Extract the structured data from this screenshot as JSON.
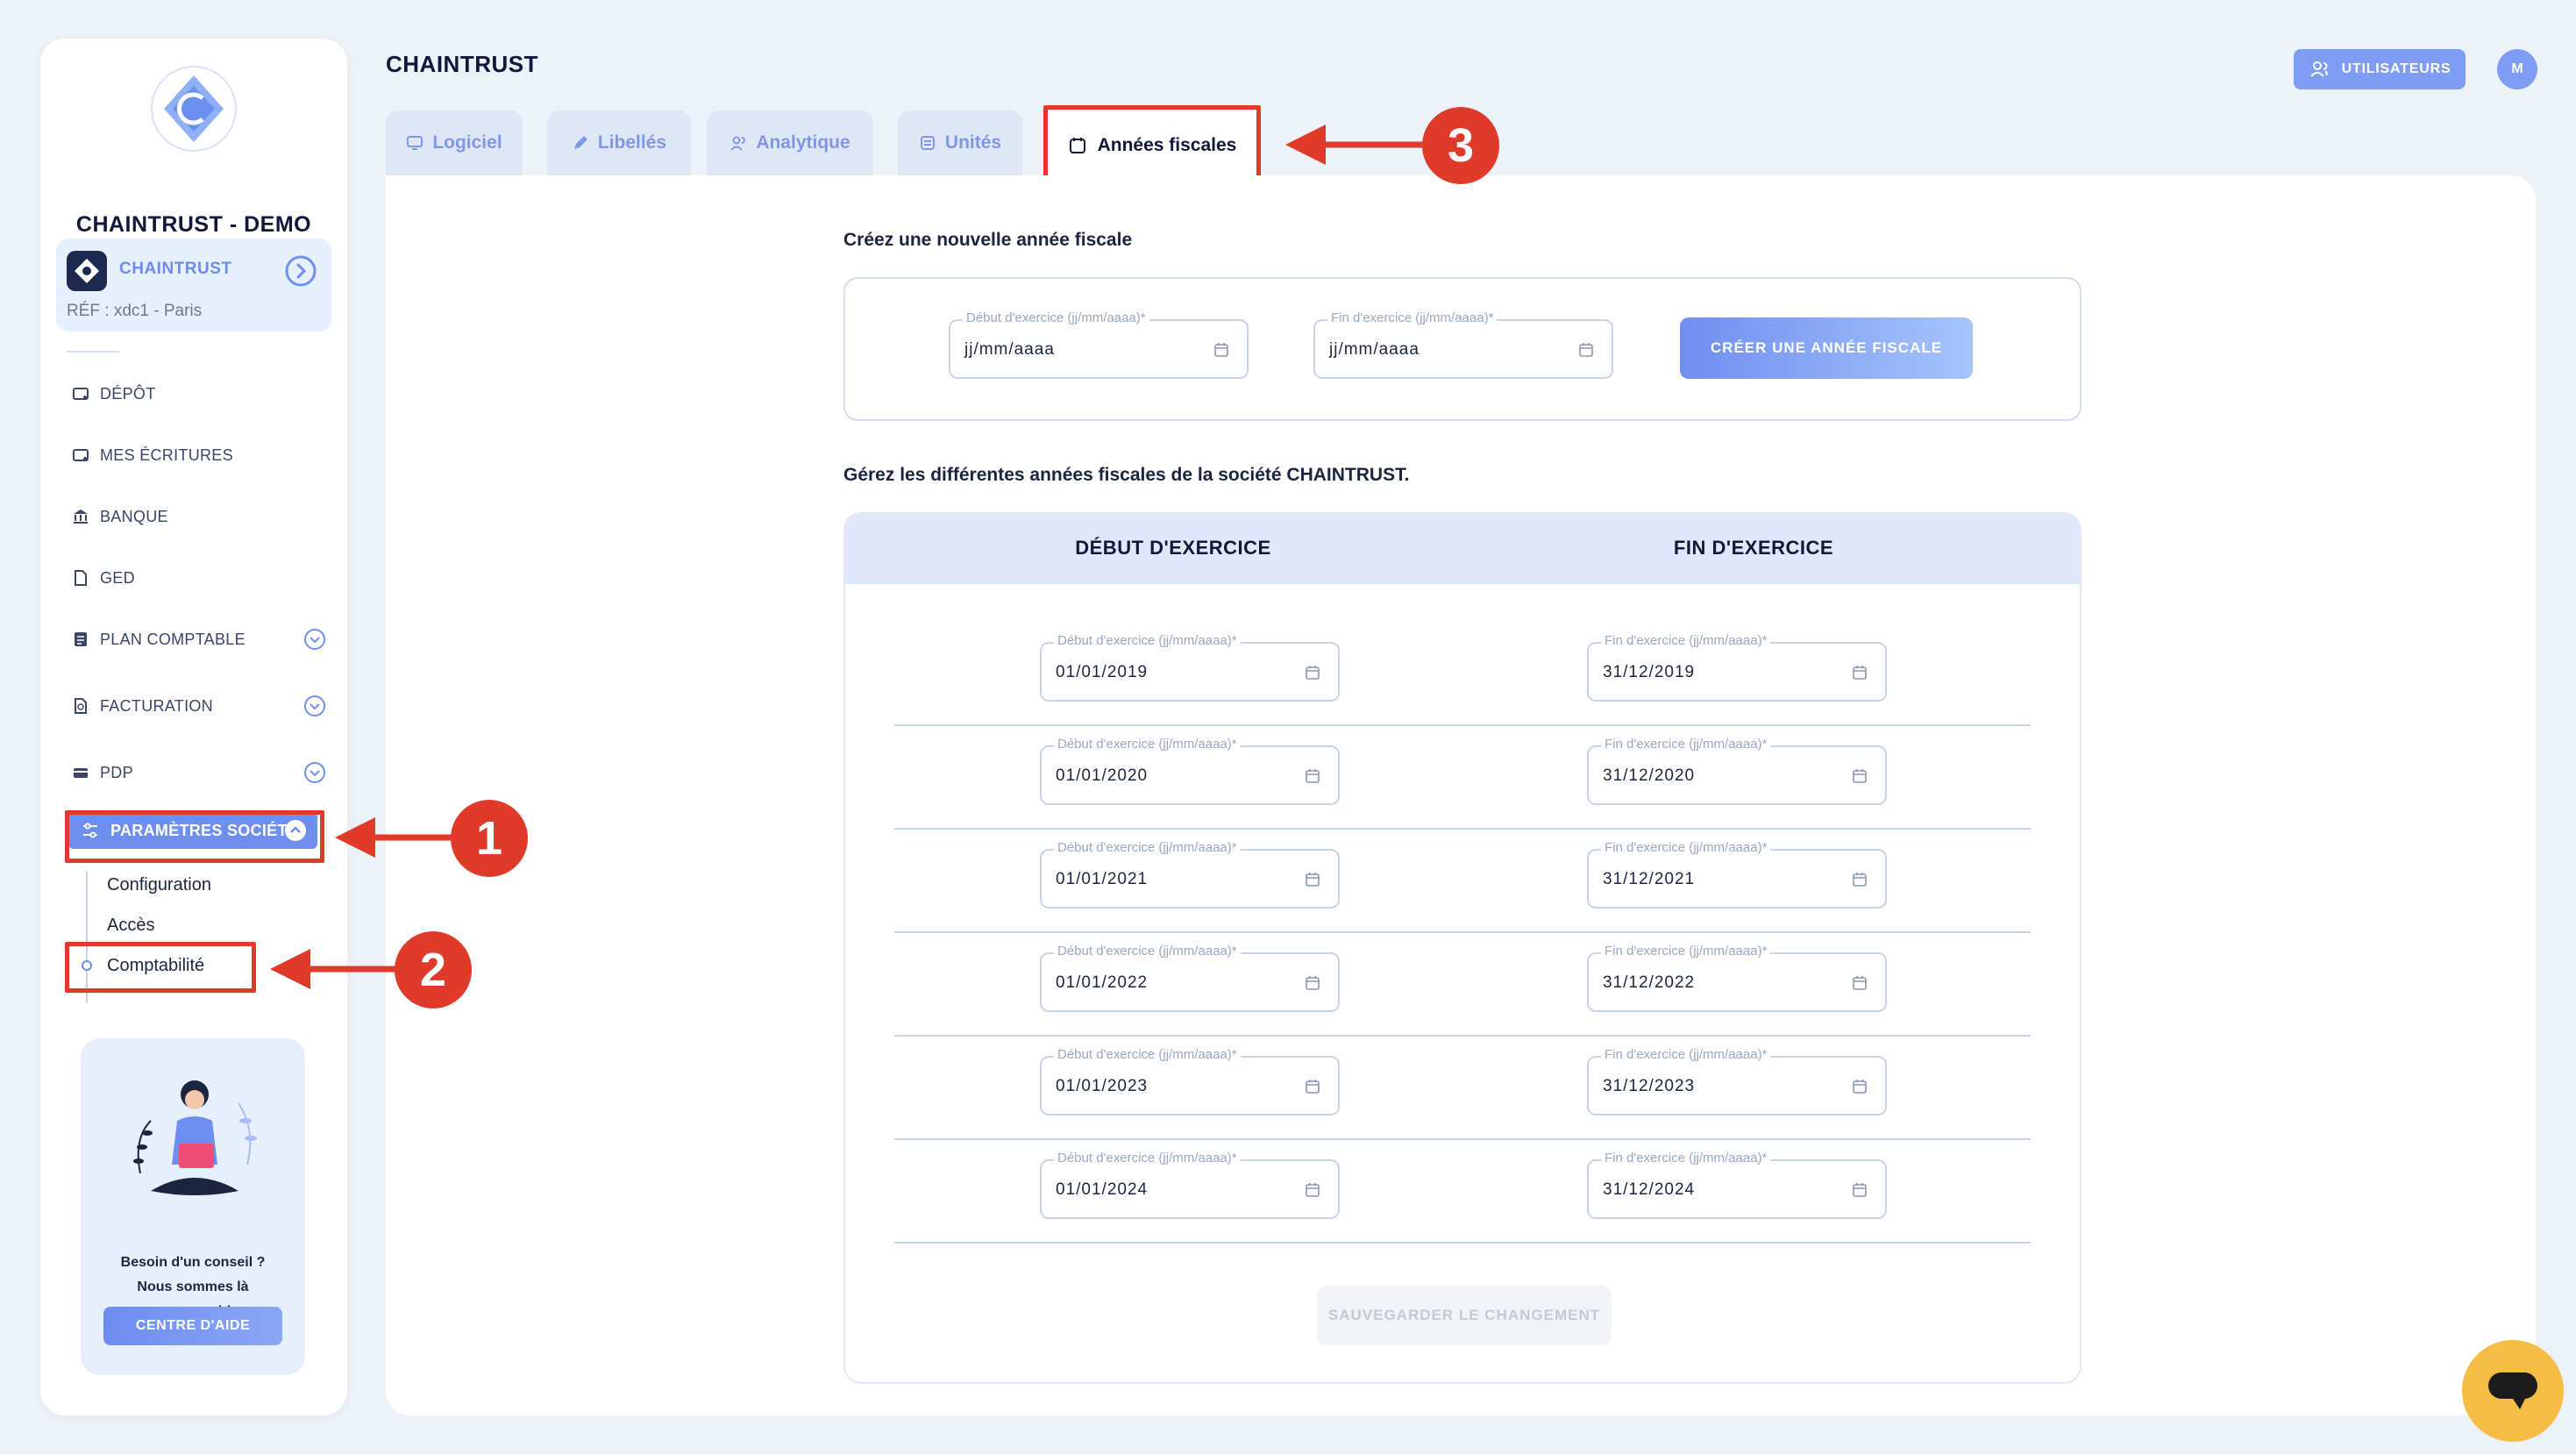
{
  "app": {
    "company_name": "CHAINTRUST - DEMO",
    "page_title": "CHAINTRUST"
  },
  "company_card": {
    "name": "CHAINTRUST",
    "ref": "RÉF : xdc1 - Paris"
  },
  "sidebar": {
    "items": [
      {
        "label": "DÉPÔT",
        "icon": "deposit-icon"
      },
      {
        "label": "MES ÉCRITURES",
        "icon": "entries-icon"
      },
      {
        "label": "BANQUE",
        "icon": "bank-icon"
      },
      {
        "label": "GED",
        "icon": "document-icon"
      },
      {
        "label": "PLAN COMPTABLE",
        "icon": "ledger-icon"
      },
      {
        "label": "FACTURATION",
        "icon": "invoice-icon"
      },
      {
        "label": "PDP",
        "icon": "card-icon"
      }
    ],
    "active_item": "PARAMÈTRES SOCIÉTÉ",
    "sub_items": [
      "Configuration",
      "Accès",
      "Comptabilité"
    ]
  },
  "help": {
    "line1": "Besoin d'un conseil ?",
    "line2": "Nous sommes là",
    "line3": "pour vous aider.",
    "button": "CENTRE D'AIDE"
  },
  "header": {
    "users_button": "UTILISATEURS",
    "avatar_initial": "M"
  },
  "tabs": [
    {
      "label": "Logiciel",
      "icon": "monitor-icon"
    },
    {
      "label": "Libellés",
      "icon": "pencil-icon"
    },
    {
      "label": "Analytique",
      "icon": "users-icon"
    },
    {
      "label": "Unités",
      "icon": "stack-icon"
    },
    {
      "label": "Années fiscales",
      "icon": "calendar-icon",
      "active": true
    }
  ],
  "create": {
    "title": "Créez une nouvelle année fiscale",
    "start_label": "Début d'exercice (jj/mm/aaaa)*",
    "start_value": "jj/mm/aaaa",
    "end_label": "Fin d'exercice (jj/mm/aaaa)*",
    "end_value": "jj/mm/aaaa",
    "button": "CRÉER UNE ANNÉE FISCALE"
  },
  "manage": {
    "title": "Gérez les différentes années fiscales de la société CHAINTRUST.",
    "col_start": "DÉBUT D'EXERCICE",
    "col_end": "FIN D'EXERCICE",
    "field_start_label": "Début d'exercice (jj/mm/aaaa)*",
    "field_end_label": "Fin d'exercice (jj/mm/aaaa)*",
    "rows": [
      {
        "start": "01/01/2019",
        "end": "31/12/2019"
      },
      {
        "start": "01/01/2020",
        "end": "31/12/2020"
      },
      {
        "start": "01/01/2021",
        "end": "31/12/2021"
      },
      {
        "start": "01/01/2022",
        "end": "31/12/2022"
      },
      {
        "start": "01/01/2023",
        "end": "31/12/2023"
      },
      {
        "start": "01/01/2024",
        "end": "31/12/2024"
      }
    ],
    "save_button": "SAUVEGARDER LE CHANGEMENT"
  },
  "annotations": [
    "1",
    "2",
    "3"
  ],
  "colors": {
    "accent": "#6e8ff0",
    "annotation": "#e03a2b",
    "chat": "#f4bd44"
  }
}
